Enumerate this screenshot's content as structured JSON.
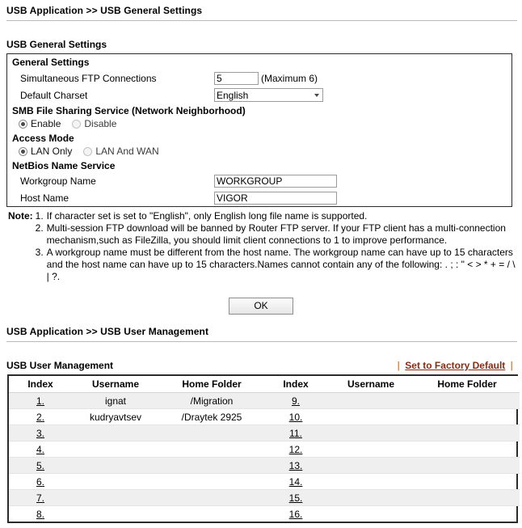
{
  "general_page": {
    "breadcrumb": "USB Application >> USB General Settings",
    "section_title": "USB General Settings",
    "panel": {
      "head": "General Settings",
      "ftp": {
        "label": "Simultaneous FTP Connections",
        "value": "5",
        "max_note": "(Maximum 6)"
      },
      "charset": {
        "label": "Default Charset",
        "value": "English"
      },
      "smb": {
        "head": "SMB File Sharing Service (Network Neighborhood)",
        "enable_label": "Enable",
        "disable_label": "Disable",
        "selected": "Enable"
      },
      "access_mode": {
        "head": "Access Mode",
        "lan_only_label": "LAN Only",
        "lan_and_wan_label": "LAN And WAN",
        "selected": "LAN Only"
      },
      "netbios": {
        "head": "NetBios Name Service",
        "workgroup_label": "Workgroup Name",
        "workgroup_value": "WORKGROUP",
        "host_label": "Host Name",
        "host_value": "VIGOR"
      }
    },
    "note": {
      "label": "Note:",
      "items": [
        {
          "num": "1.",
          "text": "If character set is set to \"English\", only English long file name is supported."
        },
        {
          "num": "2.",
          "text": "Multi-session FTP download will be banned by Router FTP server. If your FTP client has a multi-connection mechanism,such as FileZilla, you should limit client connections to 1 to improve performance."
        },
        {
          "num": "3.",
          "text": "A workgroup name must be different from the host name. The workgroup name can have up to 15 characters and the host name can have up to 15 characters.Names cannot contain any of the following: . ; : \" < > * + = / \\ | ?."
        }
      ]
    },
    "ok_button": "OK"
  },
  "user_page": {
    "breadcrumb": "USB Application >> USB User Management",
    "section_title": "USB User Management",
    "factory_default_link": "Set to Factory Default",
    "separator": "|",
    "columns": [
      "Index",
      "Username",
      "Home Folder",
      "Index",
      "Username",
      "Home Folder"
    ],
    "rows": [
      {
        "left_index": "1.",
        "left_user": "ignat",
        "left_home": "/Migration",
        "right_index": "9.",
        "right_user": "",
        "right_home": "",
        "shaded": true
      },
      {
        "left_index": "2.",
        "left_user": "kudryavtsev",
        "left_home": "/Draytek 2925",
        "right_index": "10.",
        "right_user": "",
        "right_home": "",
        "shaded": false
      },
      {
        "left_index": "3.",
        "left_user": "",
        "left_home": "",
        "right_index": "11.",
        "right_user": "",
        "right_home": "",
        "shaded": true
      },
      {
        "left_index": "4.",
        "left_user": "",
        "left_home": "",
        "right_index": "12.",
        "right_user": "",
        "right_home": "",
        "shaded": false
      },
      {
        "left_index": "5.",
        "left_user": "",
        "left_home": "",
        "right_index": "13.",
        "right_user": "",
        "right_home": "",
        "shaded": true
      },
      {
        "left_index": "6.",
        "left_user": "",
        "left_home": "",
        "right_index": "14.",
        "right_user": "",
        "right_home": "",
        "shaded": false
      },
      {
        "left_index": "7.",
        "left_user": "",
        "left_home": "",
        "right_index": "15.",
        "right_user": "",
        "right_home": "",
        "shaded": true
      },
      {
        "left_index": "8.",
        "left_user": "",
        "left_home": "",
        "right_index": "16.",
        "right_user": "",
        "right_home": "",
        "shaded": false
      }
    ]
  },
  "colors": {
    "link": "#8c2a12",
    "separator": "#e98c2e",
    "panel_border": "#2b2b2b",
    "row_shade": "#efefef"
  }
}
